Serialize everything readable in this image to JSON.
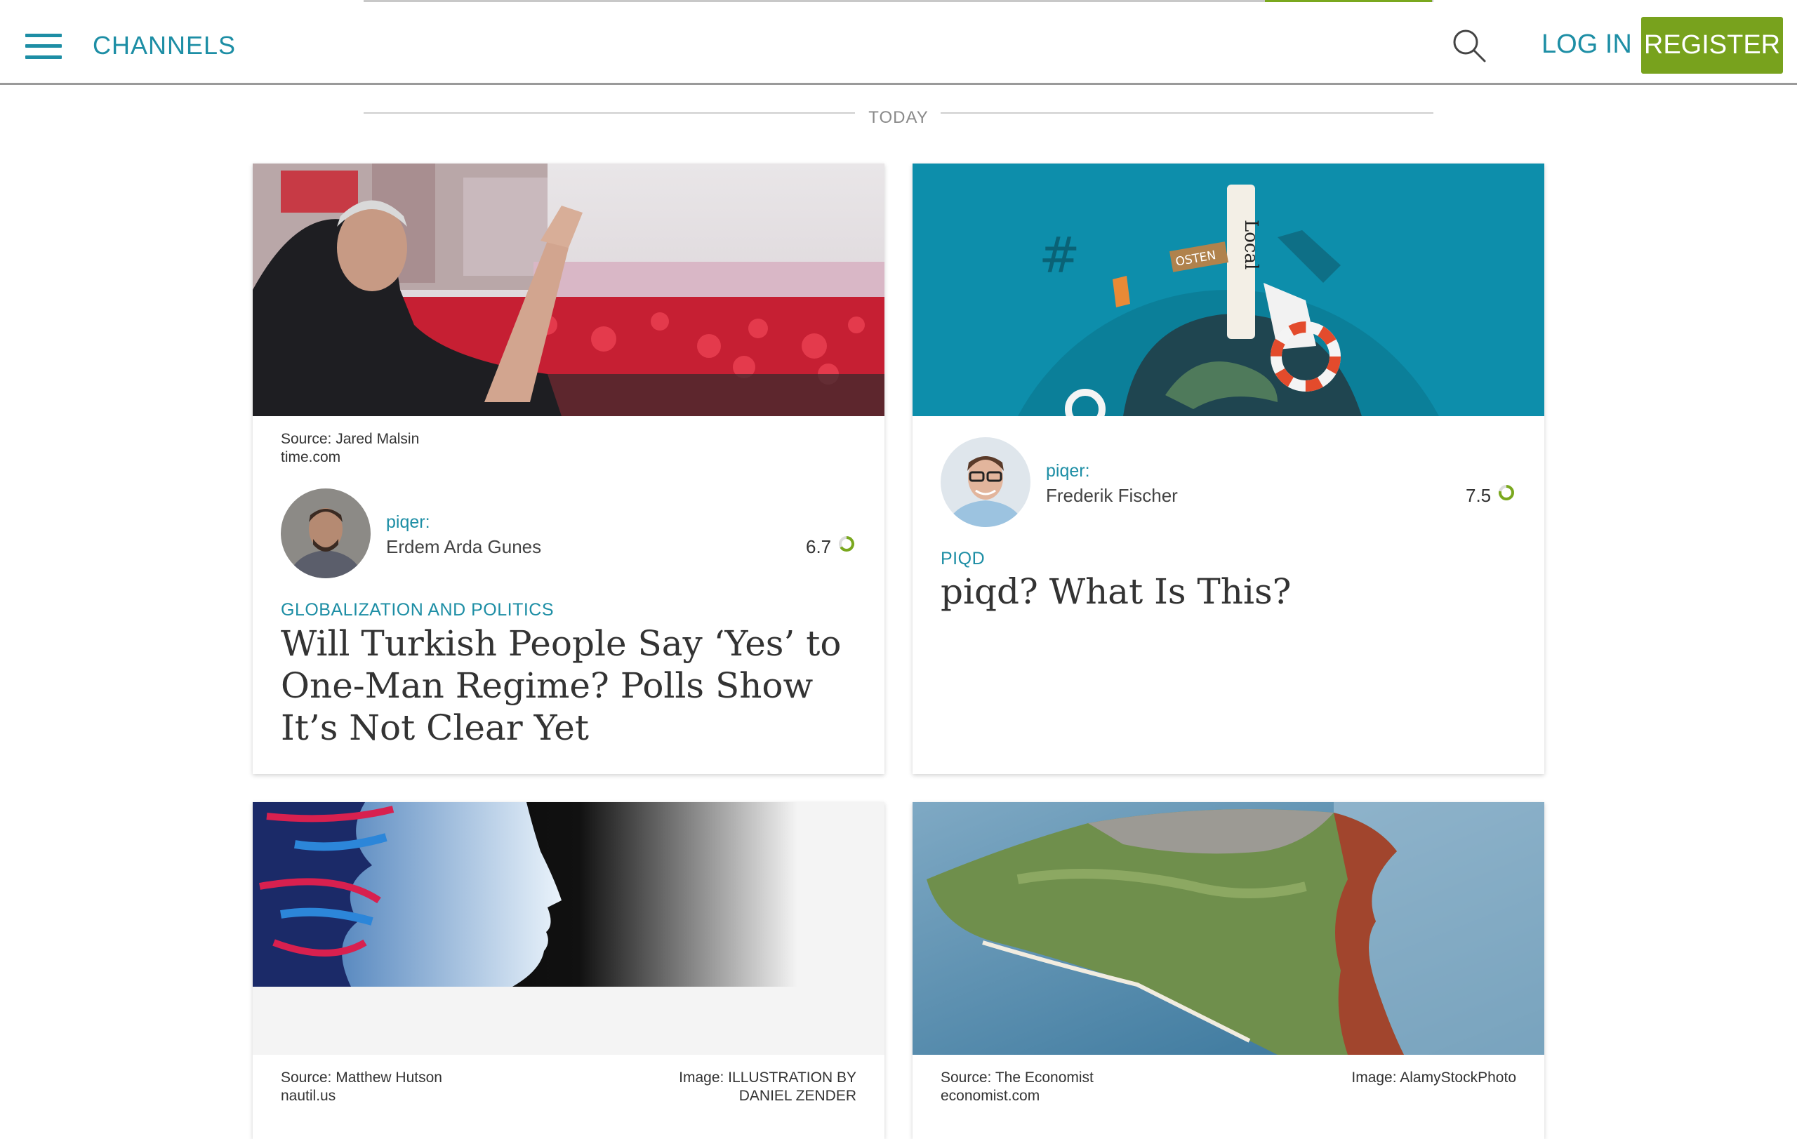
{
  "header": {
    "channels_label": "CHANNELS",
    "login_label": "LOG IN",
    "register_label": "REGISTER"
  },
  "divider": {
    "label": "TODAY"
  },
  "cards": [
    {
      "source_line1": "Source: Jared Malsin",
      "source_line2": "time.com",
      "piqer_label": "piqer:",
      "piqer_name": "Erdem Arda Gunes",
      "score": "6.7",
      "category": "GLOBALIZATION AND POLITICS",
      "title": "Will Turkish People Say ‘Yes’ to One-Man Regime? Polls Show It’s Not Clear Yet"
    },
    {
      "piqer_label": "piqer:",
      "piqer_name": "Frederik Fischer",
      "score": "7.5",
      "category": "PIQD",
      "title": "piqd? What Is This?",
      "image_words": [
        "OSTEN",
        "Local",
        "#"
      ]
    },
    {
      "source_line1": "Source: Matthew Hutson",
      "source_line2": "nautil.us",
      "image_line1": "Image: ILLUSTRATION BY",
      "image_line2": "DANIEL ZENDER"
    },
    {
      "source_line1": "Source: The Economist",
      "source_line2": "economist.com",
      "image_line1": "Image: AlamyStockPhoto"
    }
  ],
  "colors": {
    "accent": "#1d8ea5",
    "brand_green": "#78a21d",
    "progress_green": "#7aa81e"
  },
  "icons": [
    "menu-icon",
    "search-icon",
    "score-ring-icon"
  ]
}
